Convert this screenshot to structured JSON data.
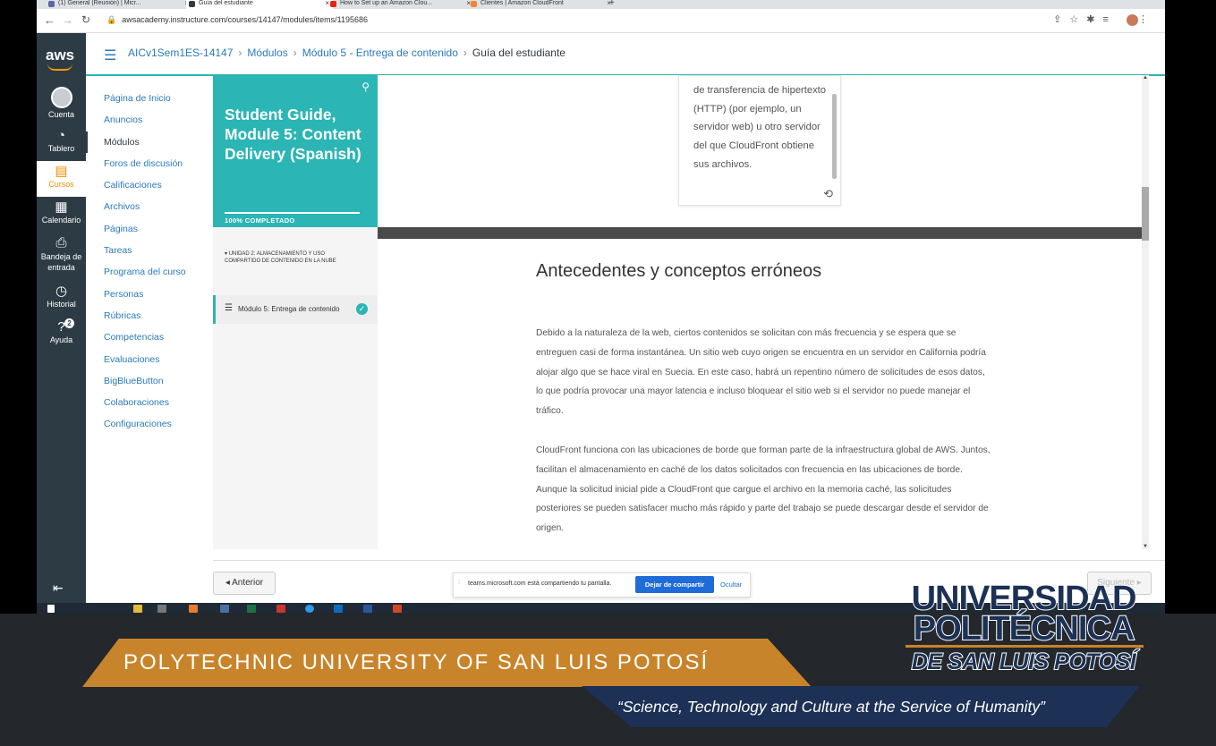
{
  "browser": {
    "tabs": [
      {
        "label": "(1) General (Reunión) | Micr...",
        "color": "#6264a7"
      },
      {
        "label": "Guía del estudiante",
        "color": "#2d3b45"
      },
      {
        "label": "How to Set up an Amazon Clou...",
        "color": "#e62117"
      },
      {
        "label": "Clientes | Amazon CloudFront",
        "color": "#f58536"
      }
    ],
    "url": "awsacademy.instructure.com/courses/14147/modules/items/1195686"
  },
  "global_nav": {
    "logo": "aws",
    "items": [
      {
        "label": "Cuenta",
        "icon": "account-icon"
      },
      {
        "label": "Tablero",
        "icon": "dashboard-icon"
      },
      {
        "label": "Cursos",
        "icon": "courses-icon"
      },
      {
        "label": "Calendario",
        "icon": "calendar-icon"
      },
      {
        "label": "Bandeja de entrada",
        "icon": "inbox-icon"
      },
      {
        "label": "Historial",
        "icon": "history-icon"
      },
      {
        "label": "Ayuda",
        "icon": "help-icon",
        "badge": "2"
      }
    ]
  },
  "breadcrumb": {
    "course": "AICv1Sem1ES-14147",
    "modules": "Módulos",
    "module": "Módulo 5 - Entrega de contenido",
    "current": "Guía del estudiante"
  },
  "course_nav": [
    {
      "label": "Página de Inicio",
      "hidden": false
    },
    {
      "label": "Anuncios",
      "hidden": true
    },
    {
      "label": "Módulos",
      "hidden": false,
      "active": true
    },
    {
      "label": "Foros de discusión",
      "hidden": false
    },
    {
      "label": "Calificaciones",
      "hidden": false
    },
    {
      "label": "Archivos",
      "hidden": true
    },
    {
      "label": "Páginas",
      "hidden": true
    },
    {
      "label": "Tareas",
      "hidden": true
    },
    {
      "label": "Programa del curso",
      "hidden": true
    },
    {
      "label": "Personas",
      "hidden": true
    },
    {
      "label": "Rúbricas",
      "hidden": true
    },
    {
      "label": "Competencias",
      "hidden": true
    },
    {
      "label": "Evaluaciones",
      "hidden": true
    },
    {
      "label": "BigBlueButton",
      "hidden": true
    },
    {
      "label": "Colaboraciones",
      "hidden": true
    },
    {
      "label": "Configuraciones",
      "hidden": false
    }
  ],
  "module_panel": {
    "title": "Student Guide, Module 5: Content Delivery (Spanish)",
    "progress": "100% COMPLETADO",
    "unit": "UNIDAD 2: ALMACENAMIENTO Y USO COMPARTIDO DE CONTENIDO EN LA NUBE",
    "item": "Módulo 5: Entrega de contenido"
  },
  "content": {
    "popup_text": "de transferencia de hipertexto (HTTP) (por ejemplo, un servidor web) u otro servidor del que CloudFront obtiene sus archivos.",
    "heading": "Antecedentes y conceptos erróneos",
    "para1": "Debido a la naturaleza de la web, ciertos contenidos se solicitan con más frecuencia y se espera que se entreguen casi de forma instantánea. Un sitio web cuyo origen se encuentra en un servidor en California podría alojar algo que se hace viral en Suecia. En este caso, habrá un repentino número de solicitudes de esos datos, lo que podría provocar una mayor latencia e incluso bloquear el sitio web si el servidor no puede manejar el tráfico.",
    "para2": "CloudFront funciona con las ubicaciones de borde que forman parte de la infraestructura global de AWS. Juntos, facilitan el almacenamiento en caché de los datos solicitados con frecuencia en las ubicaciones de borde. Aunque la solicitud inicial pide a CloudFront que cargue el archivo en la memoria caché, las solicitudes posteriores se pueden satisfacer mucho más rápido y parte del trabajo se puede descargar desde el servidor de origen."
  },
  "footer": {
    "prev": "◂ Anterior",
    "next": "Siguiente ▸",
    "share_text": "teams.microsoft.com está compartiendo tu pantalla.",
    "stop_share": "Dejar de compartir",
    "hide": "Ocultar"
  },
  "overlay": {
    "university_en": "POLYTECHNIC UNIVERSITY OF SAN LUIS POTOSÍ",
    "motto": "“Science, Technology and Culture at the Service of Humanity”",
    "logo_line1": "UNIVERSIDAD",
    "logo_line2": "POLITÉCNICA",
    "logo_line3": "DE SAN LUIS POTOSÍ"
  }
}
